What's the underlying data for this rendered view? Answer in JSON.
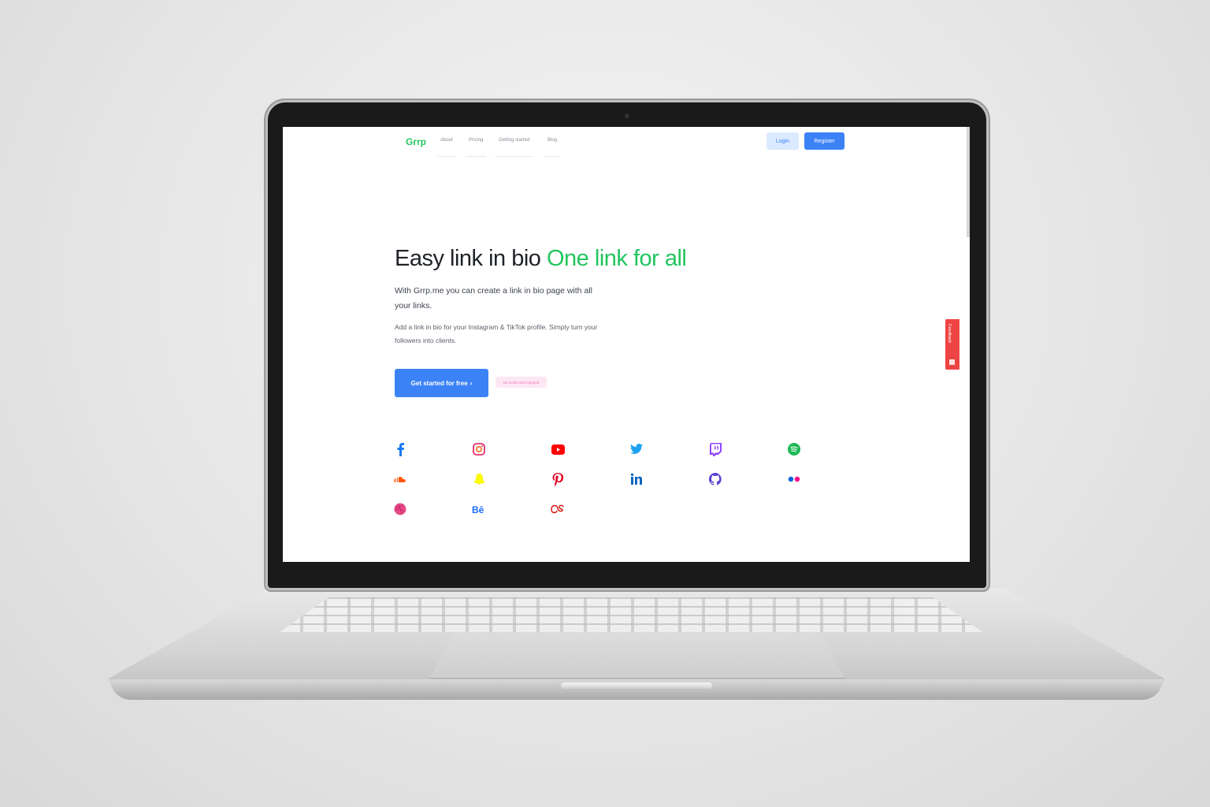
{
  "nav": {
    "logo": "Grrp",
    "links": [
      "About",
      "Pricing",
      "Getting started",
      "Blog"
    ],
    "login_label": "Login",
    "register_label": "Register"
  },
  "hero": {
    "headline_main": "Easy link in bio",
    "headline_accent": "One link for all",
    "subtitle": "With Grrp.me you can create a link in bio page with all your links.",
    "description": "Add a link in bio for your Instagram & TikTok profile. Simply turn your followers into clients.",
    "cta_label": "Get started for free",
    "cta_icon": "chevron-right-icon",
    "note": "No credit card required"
  },
  "feedback_tab": {
    "label": "Feedback",
    "color": "#ef4444"
  },
  "social_icons": [
    "facebook-icon",
    "instagram-icon",
    "youtube-icon",
    "twitter-icon",
    "twitch-icon",
    "spotify-icon",
    "soundcloud-icon",
    "snapchat-icon",
    "pinterest-icon",
    "linkedin-icon",
    "github-icon",
    "flickr-icon",
    "dribbble-icon",
    "behance-icon",
    "lastfm-icon"
  ],
  "colors": {
    "brand_green": "#22c55e",
    "primary_blue": "#3b82f6",
    "login_bg": "#dbeafe",
    "note_bg": "#fce7f3"
  }
}
